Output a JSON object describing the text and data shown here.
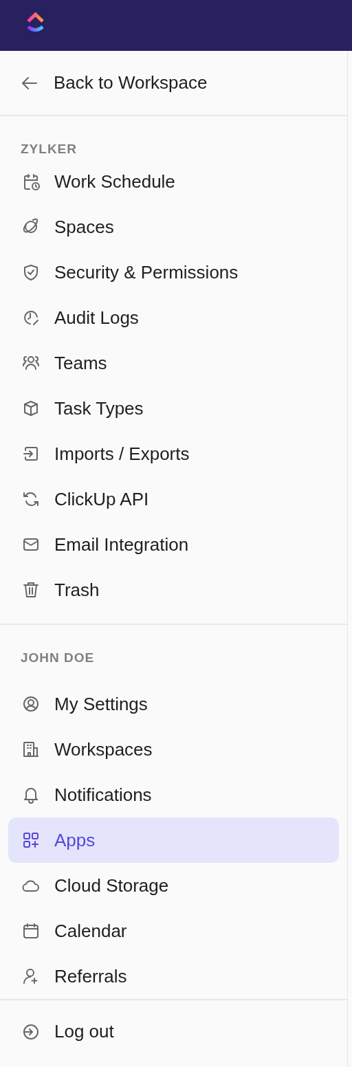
{
  "back_link": {
    "label": "Back to Workspace"
  },
  "sections": [
    {
      "title": "ZYLKER",
      "items": [
        {
          "label": "Work Schedule",
          "selected": false
        },
        {
          "label": "Spaces",
          "selected": false
        },
        {
          "label": "Security & Permissions",
          "selected": false
        },
        {
          "label": "Audit Logs",
          "selected": false
        },
        {
          "label": "Teams",
          "selected": false
        },
        {
          "label": "Task Types",
          "selected": false
        },
        {
          "label": "Imports / Exports",
          "selected": false
        },
        {
          "label": "ClickUp API",
          "selected": false
        },
        {
          "label": "Email Integration",
          "selected": false
        },
        {
          "label": "Trash",
          "selected": false
        }
      ]
    },
    {
      "title": "JOHN DOE",
      "items": [
        {
          "label": "My Settings",
          "selected": false
        },
        {
          "label": "Workspaces",
          "selected": false
        },
        {
          "label": "Notifications",
          "selected": false
        },
        {
          "label": "Apps",
          "selected": true
        },
        {
          "label": "Cloud Storage",
          "selected": false
        },
        {
          "label": "Calendar",
          "selected": false
        },
        {
          "label": "Referrals",
          "selected": false
        }
      ]
    }
  ],
  "footer": {
    "label": "Log out"
  }
}
